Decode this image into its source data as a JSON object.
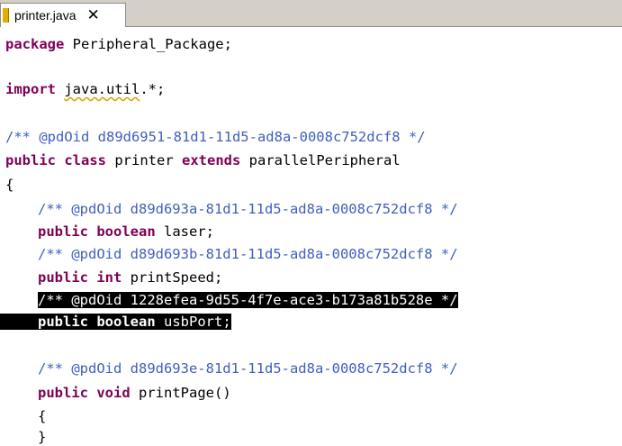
{
  "tab": {
    "label": "printer.java",
    "close_glyph": "✕",
    "icon": "java-file-icon"
  },
  "code": {
    "l1": {
      "kw": "package",
      "rest": " Peripheral_Package;"
    },
    "l2": {
      "kw": "import",
      "sq": "java.util",
      "rest": ".*;"
    },
    "l3": {
      "comment": "/** @pdOid d89d6951-81d1-11d5-ad8a-0008c752dcf8 */"
    },
    "l4": {
      "kw1": "public",
      "kw2": "class",
      "mid": " printer ",
      "kw3": "extends",
      "rest": " parallelPeripheral"
    },
    "l5": {
      "text": "{"
    },
    "l6": {
      "comment": "/** @pdOid d89d693a-81d1-11d5-ad8a-0008c752dcf8 */"
    },
    "l7": {
      "kw1": "public",
      "kw2": "boolean",
      "rest": " laser;"
    },
    "l8": {
      "comment": "/** @pdOid d89d693b-81d1-11d5-ad8a-0008c752dcf8 */"
    },
    "l9": {
      "kw1": "public",
      "kw2": "int",
      "rest": " printSpeed;"
    },
    "l10": {
      "comment": "/** @pdOid 1228efea-9d55-4f7e-ace3-b173a81b528e */"
    },
    "l11": {
      "kw1": "public",
      "kw2": "boolean",
      "rest": " usbPort;"
    },
    "l12": {
      "comment": "/** @pdOid d89d693e-81d1-11d5-ad8a-0008c752dcf8 */"
    },
    "l13": {
      "kw1": "public",
      "kw2": "void",
      "rest": " printPage()"
    },
    "l14": {
      "text": "{"
    },
    "l15": {
      "text": "}"
    }
  },
  "colors": {
    "keyword": "#7f0055",
    "comment": "#3f5fbf",
    "selection": "#000000"
  }
}
